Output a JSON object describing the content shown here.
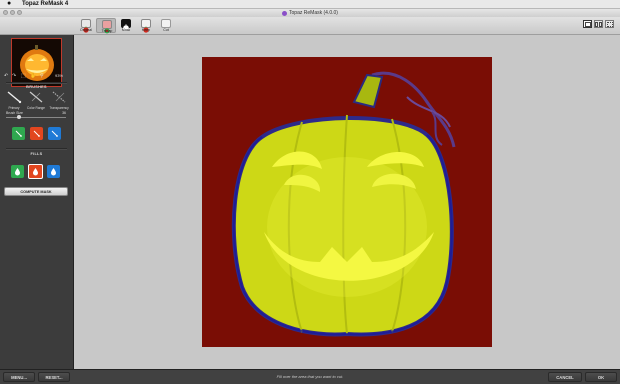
{
  "menubar": {
    "app_name": "Topaz ReMask 4"
  },
  "window": {
    "title": "Topaz ReMask (4.0.0)"
  },
  "toolbar": {
    "tabs": [
      {
        "label": "Original",
        "icon": "apple-icon"
      },
      {
        "label": "Trimap",
        "icon": "trimap-icon"
      },
      {
        "label": "Mask",
        "icon": "mask-icon"
      },
      {
        "label": "Keep",
        "icon": "keep-icon"
      },
      {
        "label": "Cut",
        "icon": "cut-icon"
      }
    ],
    "active_tab": "Trimap"
  },
  "sidebar": {
    "zoom": "93%",
    "brushes_title": "BRUSHES",
    "brushes": [
      {
        "label": "Primary"
      },
      {
        "label": "Color Range"
      },
      {
        "label": "Transparency"
      }
    ],
    "brush_size_label": "Brush Size",
    "brush_size_value": "36",
    "brush_size_level": 0.2,
    "fills_title": "FILLS",
    "compute_label": "COMPUTE MASK"
  },
  "bottom": {
    "menu_label": "MENU...",
    "reset_label": "RESET...",
    "status_text": "Fill over the area that you want to cut.",
    "cancel_label": "CANCEL",
    "ok_label": "OK"
  },
  "colors": {
    "keep_green": "#2fa84f",
    "cut_red": "#e2461f",
    "compute_blue": "#1f7ad6",
    "mask_background": "#7a0d05",
    "mask_yellow": "#d4e01a"
  }
}
